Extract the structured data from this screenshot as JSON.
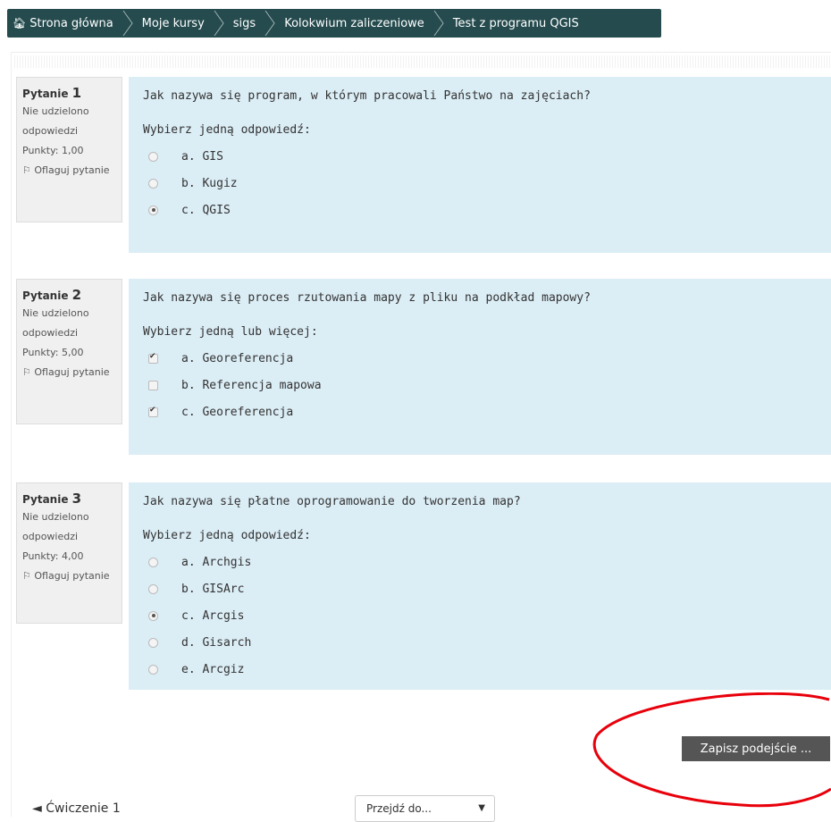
{
  "breadcrumb": [
    {
      "label": "Strona główna",
      "icon": "home-icon"
    },
    {
      "label": "Moje kursy"
    },
    {
      "label": "sigs"
    },
    {
      "label": "Kolokwium zaliczeniowe"
    },
    {
      "label": "Test z programu QGIS"
    }
  ],
  "questions": [
    {
      "label": "Pytanie",
      "number": "1",
      "state": "Nie udzielono odpowiedzi",
      "points": "Punkty: 1,00",
      "flag_label": "Oflaguj pytanie",
      "text": "Jak nazywa się program, w którym pracowali Państwo na zajęciach?",
      "prompt": "Wybierz jedną odpowiedź:",
      "type": "radio",
      "options": [
        {
          "label": "a. GIS",
          "selected": false
        },
        {
          "label": "b. Kugiz",
          "selected": false
        },
        {
          "label": "c. QGIS",
          "selected": true
        }
      ]
    },
    {
      "label": "Pytanie",
      "number": "2",
      "state": "Nie udzielono odpowiedzi",
      "points": "Punkty: 5,00",
      "flag_label": "Oflaguj pytanie",
      "text": "Jak nazywa się proces rzutowania mapy z pliku na podkład mapowy?",
      "prompt": "Wybierz jedną lub więcej:",
      "type": "checkbox",
      "options": [
        {
          "label": "a. Georeferencja",
          "selected": true
        },
        {
          "label": "b. Referencja mapowa",
          "selected": false
        },
        {
          "label": "c. Georeferencja",
          "selected": true
        }
      ]
    },
    {
      "label": "Pytanie",
      "number": "3",
      "state": "Nie udzielono odpowiedzi",
      "points": "Punkty: 4,00",
      "flag_label": "Oflaguj pytanie",
      "text": "Jak nazywa się płatne oprogramowanie do tworzenia map?",
      "prompt": "Wybierz jedną odpowiedź:",
      "type": "radio",
      "options": [
        {
          "label": "a. Archgis",
          "selected": false
        },
        {
          "label": "b. GISArc",
          "selected": false
        },
        {
          "label": "c. Arcgis",
          "selected": true
        },
        {
          "label": "d. Gisarch",
          "selected": false
        },
        {
          "label": "e. Arcgiz",
          "selected": false
        }
      ]
    }
  ],
  "submit_label": "Zapisz podejście ...",
  "prev_link": "◄ Ćwiczenie 1",
  "jump_label": "Przejdź do...",
  "highlight_color": "#e8000b"
}
